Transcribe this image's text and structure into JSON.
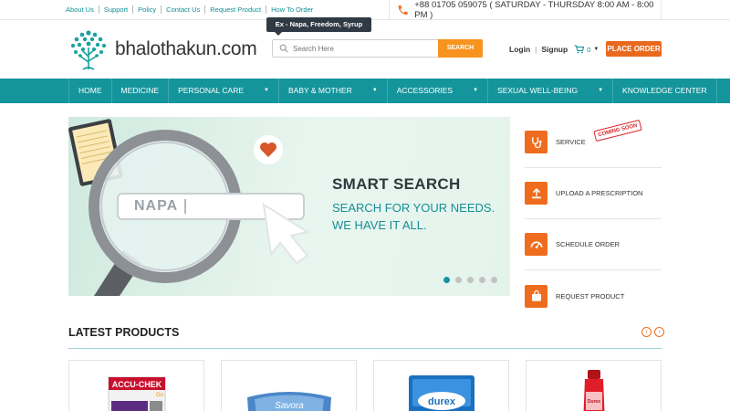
{
  "top_links": [
    "About Us",
    "Support",
    "Policy",
    "Contact Us",
    "Request Product",
    "How To Order"
  ],
  "hotline": "+88 01705 059075 ( SATURDAY - THURSDAY 8:00 AM - 8:00 PM )",
  "brand": "bhalothakun.com",
  "search": {
    "tooltip": "Ex - Napa, Freedom, Syrup",
    "placeholder": "Search Here",
    "button": "SEARCH"
  },
  "account": {
    "login": "Login",
    "signup": "Signup",
    "cart_count": "0"
  },
  "place_order": "PLACE ORDER",
  "nav": [
    {
      "label": "HOME",
      "dropdown": false
    },
    {
      "label": "MEDICINE",
      "dropdown": false
    },
    {
      "label": "PERSONAL CARE",
      "dropdown": true
    },
    {
      "label": "BABY & MOTHER",
      "dropdown": true
    },
    {
      "label": "ACCESSORIES",
      "dropdown": true
    },
    {
      "label": "SEXUAL WELL-BEING",
      "dropdown": true
    },
    {
      "label": "KNOWLEDGE CENTER",
      "dropdown": false
    }
  ],
  "banner": {
    "field_text": "NAPA",
    "title": "SMART SEARCH",
    "line1": "SEARCH FOR YOUR NEEDS.",
    "line2": "WE HAVE IT ALL.",
    "slides": 5,
    "active_slide": 1
  },
  "services": [
    {
      "label": "SERVICE",
      "icon": "stethoscope-icon",
      "badge": "COMING SOON"
    },
    {
      "label": "UPLOAD A PRESCRIPTION",
      "icon": "upload-icon"
    },
    {
      "label": "SCHEDULE ORDER",
      "icon": "gauge-icon"
    },
    {
      "label": "REQUEST PRODUCT",
      "icon": "shopping-bag-icon"
    }
  ],
  "latest": {
    "title": "LATEST PRODUCTS"
  },
  "products": [
    {
      "brand": "ACCU-CHEK",
      "sub": "Go"
    },
    {
      "brand": "Savora"
    },
    {
      "brand": "durex"
    },
    {
      "brand": "Durex"
    }
  ],
  "colors": {
    "teal": "#14959b",
    "orange": "#ef6c1e",
    "search_orange": "#f7931e"
  }
}
